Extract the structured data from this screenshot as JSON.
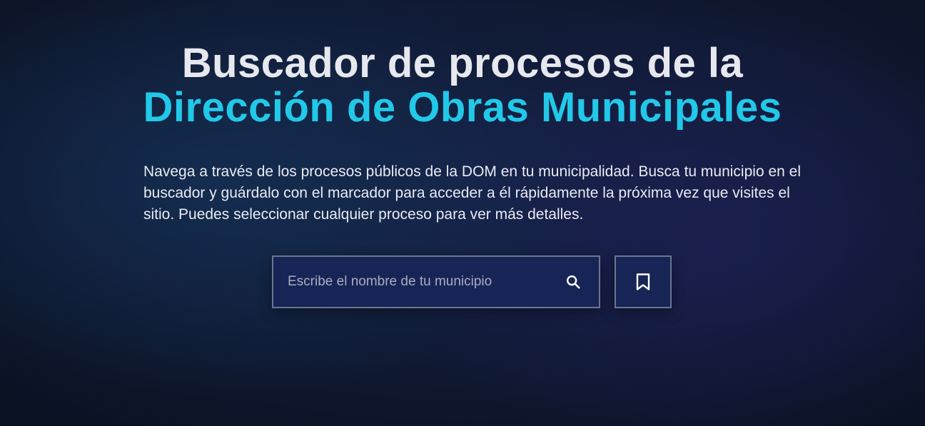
{
  "hero": {
    "title_line1": "Buscador de procesos de la",
    "title_line2": "Dirección de Obras Municipales",
    "description": "Navega a través de los procesos públicos de la DOM en tu municipalidad. Busca tu municipio en el buscador y guárdalo con el marcador para acceder a él rápidamente la próxima vez que visites el sitio. Puedes seleccionar cualquier proceso para ver más detalles."
  },
  "search": {
    "placeholder": "Escribe el nombre de tu municipio",
    "value": "",
    "icon": "search-icon"
  },
  "bookmark": {
    "icon": "bookmark-icon"
  },
  "colors": {
    "background": "#101a34",
    "title_primary": "#e6e8ee",
    "title_accent": "#22c8e8",
    "field_background": "#172456",
    "field_border": "#6c7590"
  }
}
